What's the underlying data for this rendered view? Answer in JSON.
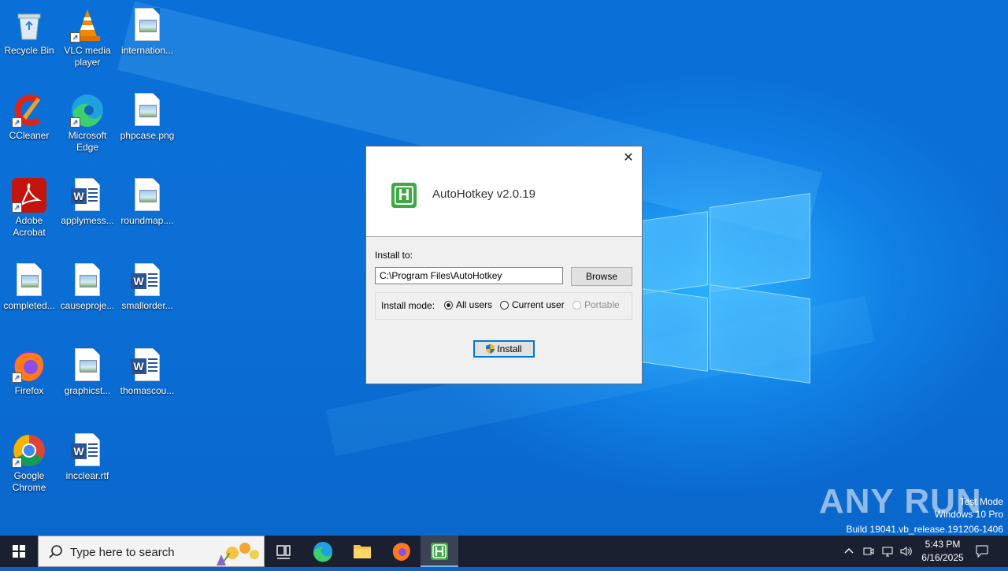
{
  "desktop": {
    "icons": [
      {
        "label": "Recycle Bin"
      },
      {
        "label": "VLC media player"
      },
      {
        "label": "internation..."
      },
      {
        "label": "CCleaner"
      },
      {
        "label": "Microsoft Edge"
      },
      {
        "label": "phpcase.png"
      },
      {
        "label": "Adobe Acrobat"
      },
      {
        "label": "applymess..."
      },
      {
        "label": "roundmap...."
      },
      {
        "label": "completed..."
      },
      {
        "label": "causeproje..."
      },
      {
        "label": "smallorder..."
      },
      {
        "label": "Firefox"
      },
      {
        "label": "graphicst..."
      },
      {
        "label": "thomascou..."
      },
      {
        "label": "Google Chrome"
      },
      {
        "label": "incclear.rtf"
      }
    ]
  },
  "dialog": {
    "title": "AutoHotkey v2.0.19",
    "logo_letter": "H",
    "install_to_label": "Install to:",
    "install_path": "C:\\Program Files\\AutoHotkey",
    "browse_label": "Browse",
    "install_mode_label": "Install mode:",
    "modes": [
      {
        "label": "All users",
        "selected": true,
        "disabled": false
      },
      {
        "label": "Current user",
        "selected": false,
        "disabled": false
      },
      {
        "label": "Portable",
        "selected": false,
        "disabled": true
      }
    ],
    "install_label": "Install",
    "close_glyph": "✕"
  },
  "watermark": {
    "brand": "ANY RUN",
    "line1": "Test Mode",
    "line2": "Windows 10 Pro",
    "line3": "Build 19041.vb_release.191206-1406"
  },
  "taskbar": {
    "search_placeholder": "Type here to search",
    "time": "5:43 PM",
    "date": "6/16/2025"
  },
  "colors": {
    "accent": "#0078d7",
    "ahk_green": "#3eaa43",
    "taskbar": "#1a2030"
  }
}
